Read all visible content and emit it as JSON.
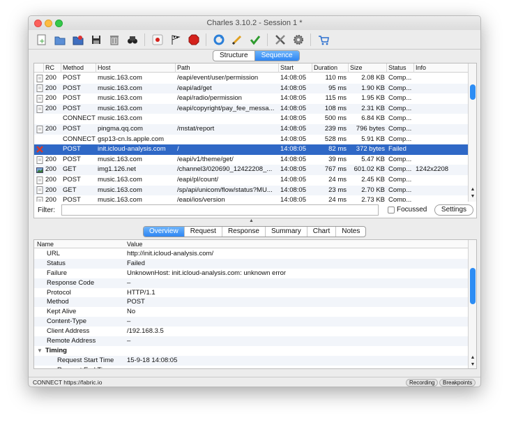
{
  "window": {
    "title": "Charles 3.10.2 - Session 1 *"
  },
  "toolbar": {
    "icons": [
      "new-session-icon",
      "open-session-icon",
      "import-icon",
      "save-icon",
      "trash-icon",
      "find-icon",
      "record-icon",
      "throttle-icon",
      "breakpoints-icon",
      "repeat-icon",
      "edit-icon",
      "validate-icon",
      "tools-icon",
      "settings-icon",
      "shopping-cart-icon"
    ]
  },
  "view_switch": {
    "structure": "Structure",
    "sequence": "Sequence"
  },
  "sessions": {
    "columns": [
      "RC",
      "Method",
      "Host",
      "Path",
      "Start",
      "Duration",
      "Size",
      "Status",
      "Info"
    ],
    "rows": [
      {
        "icon": "doc",
        "rc": "200",
        "method": "POST",
        "host": "music.163.com",
        "path": "/eapi/event/user/permission",
        "start": "14:08:05",
        "duration": "110 ms",
        "size": "2.08 KB",
        "status": "Comp...",
        "info": ""
      },
      {
        "icon": "doc",
        "rc": "200",
        "method": "POST",
        "host": "music.163.com",
        "path": "/eapi/ad/get",
        "start": "14:08:05",
        "duration": "95 ms",
        "size": "1.90 KB",
        "status": "Comp...",
        "info": ""
      },
      {
        "icon": "doc",
        "rc": "200",
        "method": "POST",
        "host": "music.163.com",
        "path": "/eapi/radio/permission",
        "start": "14:08:05",
        "duration": "115 ms",
        "size": "1.95 KB",
        "status": "Comp...",
        "info": ""
      },
      {
        "icon": "doc",
        "rc": "200",
        "method": "POST",
        "host": "music.163.com",
        "path": "/eapi/copyright/pay_fee_messa...",
        "start": "14:08:05",
        "duration": "108 ms",
        "size": "2.31 KB",
        "status": "Comp...",
        "info": ""
      },
      {
        "icon": "blank",
        "rc": "",
        "method": "CONNECT",
        "host": "music.163.com",
        "path": "",
        "start": "14:08:05",
        "duration": "500 ms",
        "size": "6.84 KB",
        "status": "Comp...",
        "info": ""
      },
      {
        "icon": "doc",
        "rc": "200",
        "method": "POST",
        "host": "pingma.qq.com",
        "path": "/mstat/report",
        "start": "14:08:05",
        "duration": "239 ms",
        "size": "796 bytes",
        "status": "Comp...",
        "info": ""
      },
      {
        "icon": "blank",
        "rc": "",
        "method": "CONNECT",
        "host": "gsp13-cn.ls.apple.com",
        "path": "",
        "start": "14:08:05",
        "duration": "528 ms",
        "size": "5.91 KB",
        "status": "Comp...",
        "info": ""
      },
      {
        "icon": "error",
        "rc": "",
        "method": "POST",
        "host": "init.icloud-analysis.com",
        "path": "/",
        "start": "14:08:05",
        "duration": "82 ms",
        "size": "372 bytes",
        "status": "Failed",
        "info": ""
      },
      {
        "icon": "doc",
        "rc": "200",
        "method": "POST",
        "host": "music.163.com",
        "path": "/eapi/v1/theme/get/",
        "start": "14:08:05",
        "duration": "39 ms",
        "size": "5.47 KB",
        "status": "Comp...",
        "info": ""
      },
      {
        "icon": "image",
        "rc": "200",
        "method": "GET",
        "host": "img1.126.net",
        "path": "/channel3/020690_12422208_...",
        "start": "14:08:05",
        "duration": "767 ms",
        "size": "601.02 KB",
        "status": "Comp...",
        "info": "1242x2208"
      },
      {
        "icon": "doc",
        "rc": "200",
        "method": "POST",
        "host": "music.163.com",
        "path": "/eapi/pl/count/",
        "start": "14:08:05",
        "duration": "24 ms",
        "size": "2.45 KB",
        "status": "Comp...",
        "info": ""
      },
      {
        "icon": "doc",
        "rc": "200",
        "method": "GET",
        "host": "music.163.com",
        "path": "/sp/api/unicom/flow/status?MU...",
        "start": "14:08:05",
        "duration": "23 ms",
        "size": "2.70 KB",
        "status": "Comp...",
        "info": ""
      },
      {
        "icon": "doc",
        "rc": "200",
        "method": "POST",
        "host": "music.163.com",
        "path": "/eapi/ios/version",
        "start": "14:08:05",
        "duration": "24 ms",
        "size": "2.73 KB",
        "status": "Comp...",
        "info": ""
      }
    ],
    "selected_index": 7
  },
  "filter": {
    "label": "Filter:",
    "value": "",
    "focussed_label": "Focussed",
    "settings_label": "Settings"
  },
  "detail_tabs": [
    "Overview",
    "Request",
    "Response",
    "Summary",
    "Chart",
    "Notes"
  ],
  "overview": {
    "columns": [
      "Name",
      "Value"
    ],
    "rows": [
      {
        "type": "field",
        "name": "URL",
        "value": "http://init.icloud-analysis.com/"
      },
      {
        "type": "field",
        "name": "Status",
        "value": "Failed"
      },
      {
        "type": "field",
        "name": "Failure",
        "value": "UnknownHost: init.icloud-analysis.com: unknown error"
      },
      {
        "type": "field",
        "name": "Response Code",
        "value": "–"
      },
      {
        "type": "field",
        "name": "Protocol",
        "value": "HTTP/1.1"
      },
      {
        "type": "field",
        "name": "Method",
        "value": "POST"
      },
      {
        "type": "field",
        "name": "Kept Alive",
        "value": "No"
      },
      {
        "type": "field",
        "name": "Content-Type",
        "value": "–"
      },
      {
        "type": "field",
        "name": "Client Address",
        "value": "/192.168.3.5"
      },
      {
        "type": "field",
        "name": "Remote Address",
        "value": "–"
      },
      {
        "type": "group",
        "name": "Timing",
        "value": ""
      },
      {
        "type": "sub",
        "name": "Request Start Time",
        "value": "15-9-18 14:08:05"
      },
      {
        "type": "sub",
        "name": "Request End Time",
        "value": ""
      }
    ]
  },
  "statusbar": {
    "text": "CONNECT https://fabric.io",
    "recording": "Recording",
    "breakpoints": "Breakpoints"
  },
  "colors": {
    "selection": "#2f68c6",
    "accent": "#2f86f3",
    "error": "#d23b2f"
  }
}
